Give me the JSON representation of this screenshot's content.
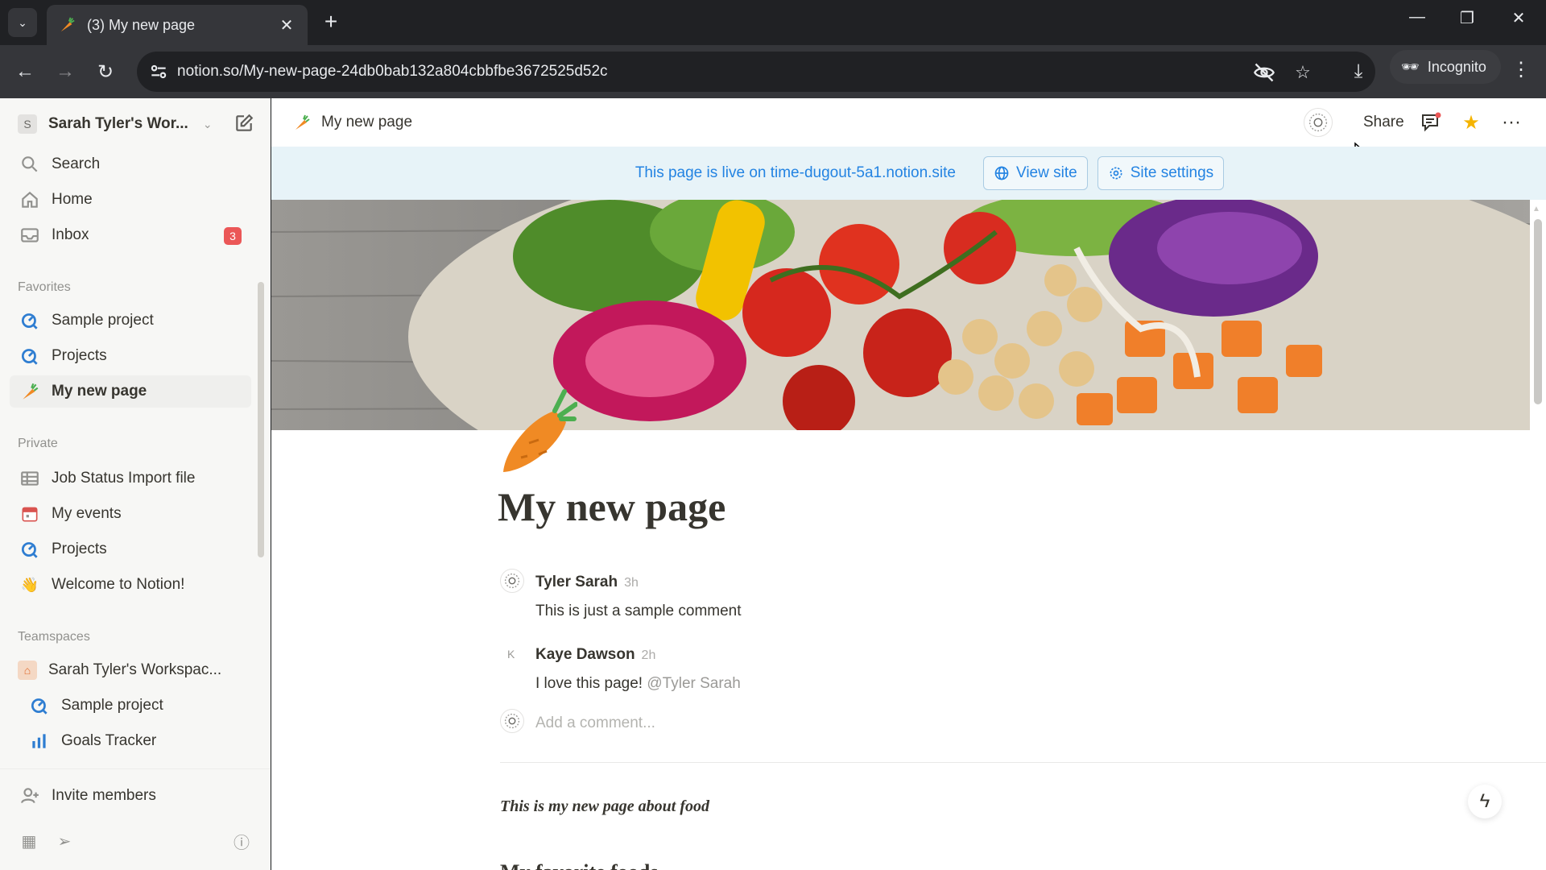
{
  "browser": {
    "tab_title": "(3) My new page",
    "tab_close": "✕",
    "new_tab": "+",
    "url": "notion.so/My-new-page-24db0bab132a804cbbfbe3672525d52c",
    "profile_label": "Incognito"
  },
  "sidebar": {
    "workspace_initial": "S",
    "workspace_name": "Sarah Tyler's Wor...",
    "top_items": [
      {
        "label": "Search",
        "icon": "search-icon"
      },
      {
        "label": "Home",
        "icon": "home-icon"
      },
      {
        "label": "Inbox",
        "icon": "inbox-icon",
        "badge": "3"
      }
    ],
    "favorites_label": "Favorites",
    "favorites": [
      {
        "label": "Sample project",
        "icon": "project-icon"
      },
      {
        "label": "Projects",
        "icon": "project-icon"
      },
      {
        "label": "My new page",
        "icon": "carrot-icon",
        "active": true
      }
    ],
    "private_label": "Private",
    "private": [
      {
        "label": "Job Status Import file",
        "icon": "table-icon"
      },
      {
        "label": "My events",
        "icon": "calendar-icon"
      },
      {
        "label": "Projects",
        "icon": "project-icon"
      },
      {
        "label": "Welcome to Notion!",
        "icon": "wave-icon"
      }
    ],
    "teamspaces_label": "Teamspaces",
    "teamspace_name": "Sarah Tyler's Workspac...",
    "teamspace_items": [
      {
        "label": "Sample project",
        "icon": "project-icon"
      },
      {
        "label": "Goals Tracker",
        "icon": "goals-icon"
      }
    ],
    "invite_label": "Invite members"
  },
  "topbar": {
    "breadcrumb_title": "My new page",
    "share_label": "Share"
  },
  "banner": {
    "text": "This page is live on time-dugout-5a1.notion.site",
    "view_site": "View site",
    "site_settings": "Site settings"
  },
  "page": {
    "title": "My new page",
    "comments": [
      {
        "author": "Tyler Sarah",
        "time": "3h",
        "text": "This is just a sample comment"
      },
      {
        "author": "Kaye Dawson",
        "time": "2h",
        "text": "I love this page!",
        "mention": "@Tyler Sarah",
        "initial": "K"
      }
    ],
    "comment_placeholder": "Add a comment...",
    "body_text": "This is my new page about food",
    "next_heading_peek": "My favorite foods"
  },
  "colors": {
    "accent": "#2383e2",
    "badge": "#eb5757",
    "star": "#f5b400"
  }
}
